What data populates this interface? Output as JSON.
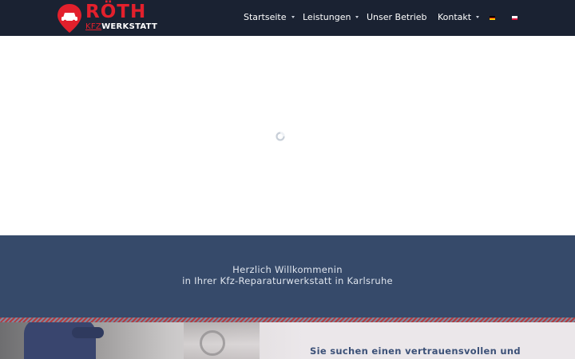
{
  "header": {
    "logo": {
      "brand": "RÖTH",
      "kfz": "KFZ",
      "werkstatt": "WERKSTATT"
    },
    "nav": [
      {
        "label": "Startseite",
        "has_dropdown": true
      },
      {
        "label": "Leistungen",
        "has_dropdown": true
      },
      {
        "label": "Unser Betrieb",
        "has_dropdown": false
      },
      {
        "label": "Kontakt",
        "has_dropdown": true
      }
    ],
    "languages": [
      {
        "code": "de",
        "icon": "flag-de-icon"
      },
      {
        "code": "pl",
        "icon": "flag-pl-icon"
      }
    ]
  },
  "hero": {
    "loading_icon": "spinner-icon"
  },
  "welcome": {
    "line1": "Herzlich Willkommenin",
    "line2": "in Ihrer Kfz-Reparaturwerkstatt in Karlsruhe"
  },
  "lower": {
    "headline": "Sie suchen einen vertrauensvollen und"
  },
  "colors": {
    "header_bg": "#1a2232",
    "brand_red": "#e2202c",
    "welcome_bg": "#364a6a",
    "headline_blue": "#3c5178"
  }
}
